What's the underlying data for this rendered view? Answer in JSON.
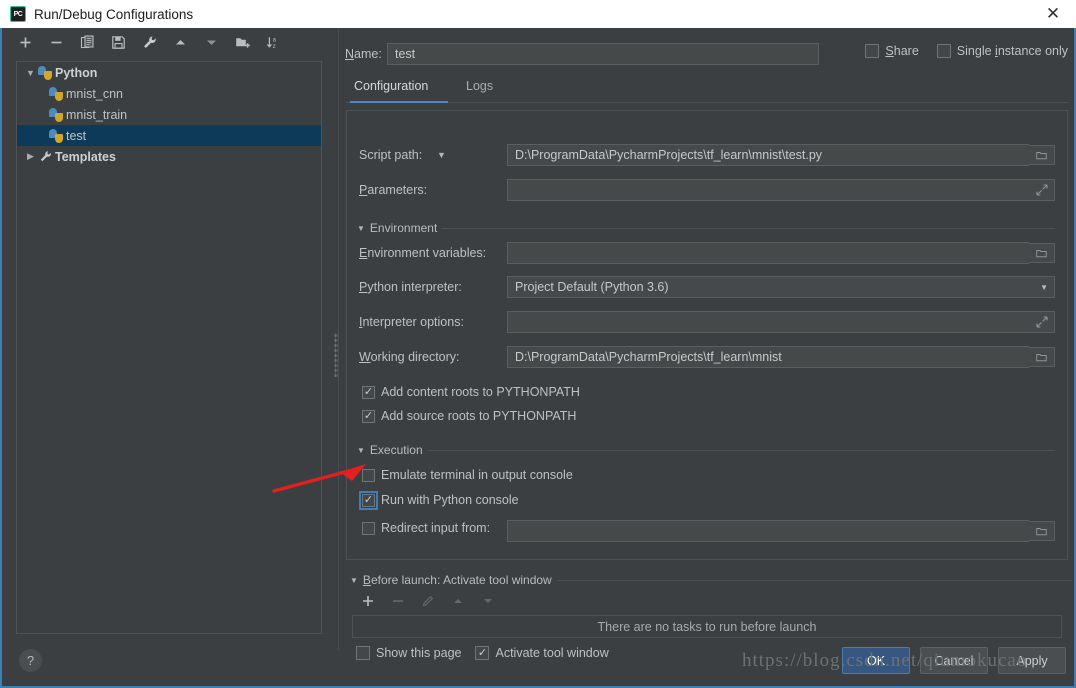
{
  "window": {
    "title": "Run/Debug Configurations",
    "app_icon": "pycharm-icon",
    "close_icon": "close-icon",
    "accent": "#4a88c7",
    "selection": "#0d3a58",
    "primary_button": "#365880"
  },
  "left_toolbar": {
    "buttons": [
      {
        "name": "add-configuration-button",
        "icon": "plus-icon",
        "label": "+"
      },
      {
        "name": "remove-configuration-button",
        "icon": "minus-icon",
        "label": "−"
      },
      {
        "name": "copy-configuration-button",
        "icon": "copy-icon",
        "label": "Copy"
      },
      {
        "name": "save-configuration-button",
        "icon": "save-icon",
        "label": "Save"
      },
      {
        "name": "edit-templates-button",
        "icon": "wrench-icon",
        "label": "Edit templates"
      },
      {
        "name": "move-up-button",
        "icon": "arrow-up-icon",
        "label": "Move up"
      },
      {
        "name": "move-down-button",
        "icon": "arrow-down-icon",
        "label": "Move down"
      },
      {
        "name": "new-folder-button",
        "icon": "new-folder-icon",
        "label": "Create new folder"
      },
      {
        "name": "sort-configurations-button",
        "icon": "sort-az-icon",
        "label": "Sort configurations"
      }
    ]
  },
  "tree": {
    "nodes": [
      {
        "label": "Python",
        "icon": "python-icon",
        "expanded": true,
        "indent": 0,
        "selected": false,
        "group": true
      },
      {
        "label": "mnist_cnn",
        "icon": "python-file-icon",
        "indent": 1,
        "selected": false,
        "group": false
      },
      {
        "label": "mnist_train",
        "icon": "python-file-icon",
        "indent": 1,
        "selected": false,
        "group": false
      },
      {
        "label": "test",
        "icon": "python-file-icon",
        "indent": 1,
        "selected": true,
        "group": false
      },
      {
        "label": "Templates",
        "icon": "wrench-icon",
        "expanded": false,
        "indent": 0,
        "selected": false,
        "group": true
      }
    ]
  },
  "help_button": {
    "label": "?",
    "icon": "question-icon"
  },
  "name_row": {
    "label": "Name:",
    "label_mnemonic": "N",
    "value": "test",
    "placeholder": ""
  },
  "top_checkboxes": [
    {
      "name": "share-checkbox",
      "label": "Share",
      "mnemonic": "S",
      "checked": false
    },
    {
      "name": "single-instance-checkbox",
      "label": "Single instance only",
      "mnemonic": "i",
      "checked": false
    }
  ],
  "tabs": [
    {
      "name": "tab-configuration",
      "label": "Configuration",
      "active": true
    },
    {
      "name": "tab-logs",
      "label": "Logs",
      "active": false
    }
  ],
  "config": {
    "script_path": {
      "label": "Script path:",
      "value": "D:\\ProgramData\\PycharmProjects\\tf_learn\\mnist\\test.py",
      "browse_icon": "folder-icon",
      "dropdown_icon": "chevron-down-icon"
    },
    "parameters": {
      "label": "Parameters:",
      "mnemonic": "P",
      "value": "",
      "expand_icon": "expand-icon"
    },
    "environment_group": {
      "label": "Environment",
      "expanded": true,
      "twisty_icon": "triangle-down-icon"
    },
    "environment_variables": {
      "label": "Environment variables:",
      "mnemonic": "E",
      "value": "",
      "browse_icon": "folder-icon"
    },
    "python_interpreter": {
      "label": "Python interpreter:",
      "mnemonic": "P",
      "value": "Project Default (Python 3.6)",
      "dropdown_icon": "chevron-down-icon"
    },
    "interpreter_options": {
      "label": "Interpreter options:",
      "mnemonic": "I",
      "value": "",
      "expand_icon": "expand-icon"
    },
    "working_directory": {
      "label": "Working directory:",
      "mnemonic": "W",
      "value": "D:\\ProgramData\\PycharmProjects\\tf_learn\\mnist",
      "browse_icon": "folder-icon"
    },
    "path_checkboxes": [
      {
        "name": "add-content-roots-checkbox",
        "label": "Add content roots to PYTHONPATH",
        "checked": true
      },
      {
        "name": "add-source-roots-checkbox",
        "label": "Add source roots to PYTHONPATH",
        "checked": true
      }
    ],
    "execution_group": {
      "label": "Execution",
      "expanded": true,
      "twisty_icon": "triangle-down-icon"
    },
    "execution_checkboxes": [
      {
        "name": "emulate-terminal-checkbox",
        "label": "Emulate terminal in output console",
        "checked": false,
        "focused": false
      },
      {
        "name": "run-with-python-console-checkbox",
        "label": "Run with Python console",
        "checked": true,
        "focused": true
      }
    ],
    "redirect_input": {
      "name": "redirect-input-checkbox",
      "label": "Redirect input from:",
      "checked": false,
      "value": "",
      "browse_icon": "folder-icon"
    }
  },
  "before_launch": {
    "header": "Before launch: Activate tool window",
    "mnemonic": "B",
    "twisty_icon": "triangle-down-icon",
    "tools": [
      {
        "name": "add-task-button",
        "icon": "plus-icon",
        "label": "+",
        "enabled": true
      },
      {
        "name": "remove-task-button",
        "icon": "minus-icon",
        "label": "−",
        "enabled": false
      },
      {
        "name": "edit-task-button",
        "icon": "pencil-icon",
        "label": "Edit",
        "enabled": false
      },
      {
        "name": "task-move-up-button",
        "icon": "arrow-up-icon",
        "label": "Up",
        "enabled": false
      },
      {
        "name": "task-move-down-button",
        "icon": "arrow-down-icon",
        "label": "Down",
        "enabled": false
      }
    ],
    "empty_text": "There are no tasks to run before launch",
    "checkboxes": [
      {
        "name": "show-this-page-checkbox",
        "label": "Show this page",
        "checked": false
      },
      {
        "name": "activate-tool-window-checkbox",
        "label": "Activate tool window",
        "checked": true
      }
    ]
  },
  "dialog_buttons": [
    {
      "name": "ok-button",
      "label": "OK",
      "primary": true
    },
    {
      "name": "cancel-button",
      "label": "Cancel",
      "primary": false
    },
    {
      "name": "apply-button",
      "label": "Apply",
      "primary": false
    }
  ],
  "watermark": {
    "text": "https://blog.csdn.net/qiumokucao"
  },
  "annotation": {
    "name": "red-arrow-annotation",
    "color": "#e32020"
  }
}
